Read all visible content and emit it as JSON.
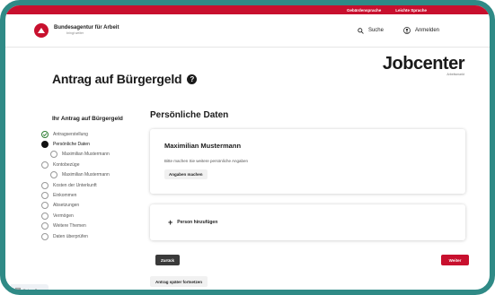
{
  "topbar": {
    "sign_language": "Gebärdensprache",
    "easy_language": "Leichte Sprache"
  },
  "header": {
    "org_name": "Bundesagentur für Arbeit",
    "org_tagline": "bringt weiter",
    "search_label": "Suche",
    "login_label": "Anmelden"
  },
  "page": {
    "title": "Antrag auf Bürgergeld",
    "help_icon": "?",
    "brand_name": "Jobcenter",
    "brand_sub": "Arbeitsmarkt"
  },
  "steps": {
    "title": "Ihr Antrag auf Bürgergeld",
    "items": [
      {
        "label": "Antragserstellung",
        "state": "done",
        "sub": false
      },
      {
        "label": "Persönliche Daten",
        "state": "active",
        "sub": false
      },
      {
        "label": "Maximilian Mustermann",
        "state": "open",
        "sub": true
      },
      {
        "label": "Kontobezüge",
        "state": "open",
        "sub": false
      },
      {
        "label": "Maximilian Mustermann",
        "state": "open",
        "sub": true
      },
      {
        "label": "Kosten der Unterkunft",
        "state": "open",
        "sub": false
      },
      {
        "label": "Einkommen",
        "state": "open",
        "sub": false
      },
      {
        "label": "Absetzungen",
        "state": "open",
        "sub": false
      },
      {
        "label": "Vermögen",
        "state": "open",
        "sub": false
      },
      {
        "label": "Weitere Themen",
        "state": "open",
        "sub": false
      },
      {
        "label": "Daten überprüfen",
        "state": "open",
        "sub": false
      }
    ]
  },
  "main": {
    "section_title": "Persönliche Daten",
    "person_name": "Maximilian Mustermann",
    "person_hint": "Bitte machen Sie weitere persönliche Angaben",
    "provide_info_button": "Angaben machen",
    "add_person_label": "Person hinzufügen",
    "add_person_icon": "+"
  },
  "footer": {
    "back_button": "Zurück",
    "next_button": "Weiter",
    "continue_later_button": "Antrag später fortsetzen",
    "debug_bar_label": "Debug Bar"
  },
  "colors": {
    "brand_red": "#c8102e",
    "frame_teal": "#2f8a86",
    "dark_button": "#3a3a3a"
  }
}
